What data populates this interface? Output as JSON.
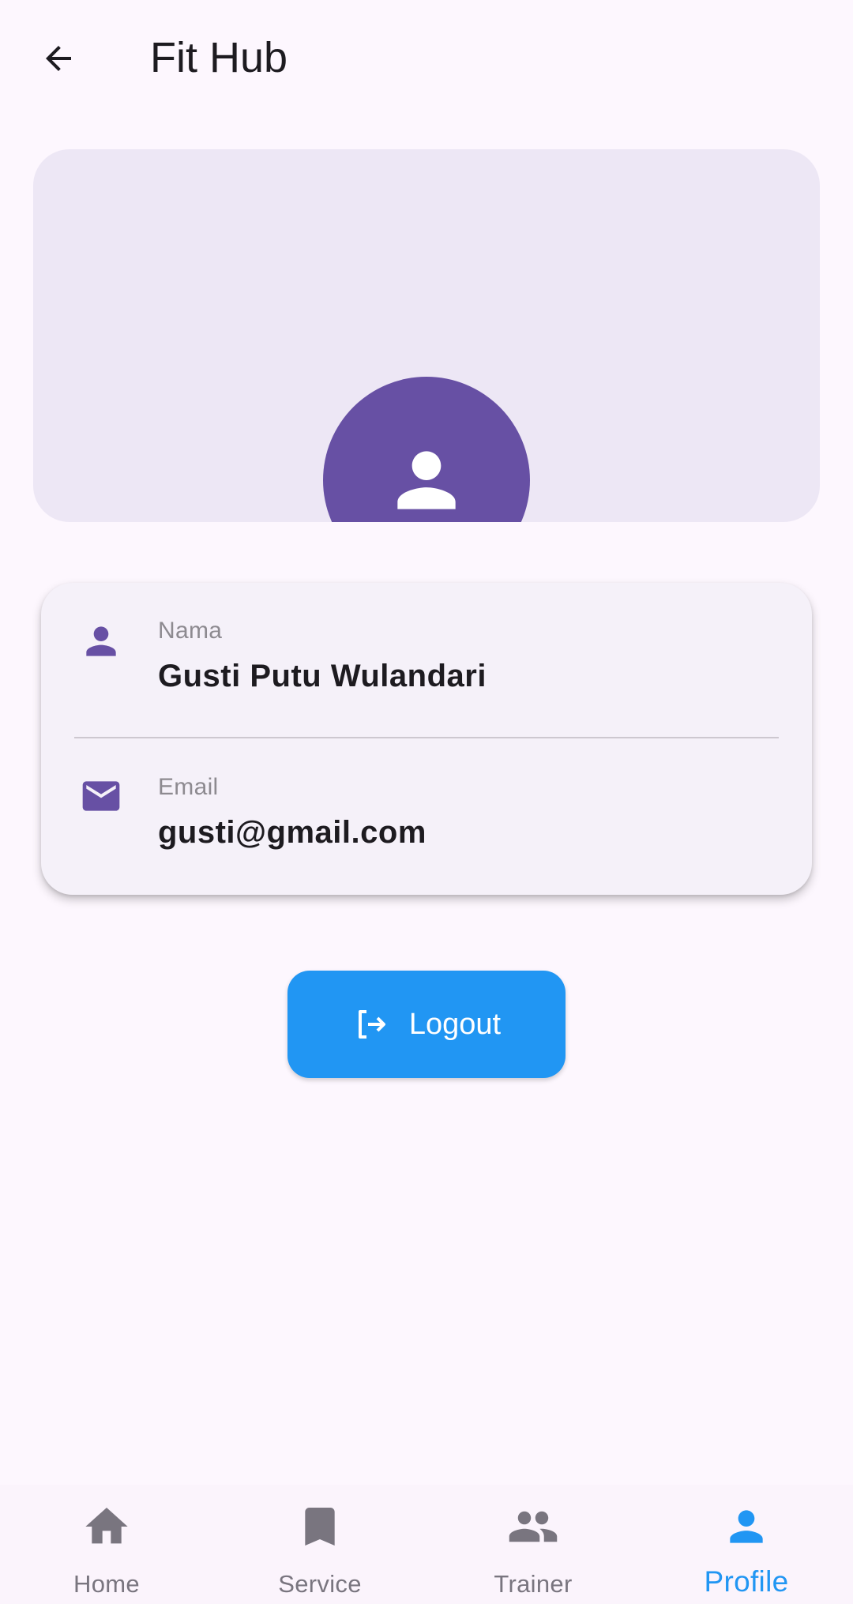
{
  "app_bar": {
    "title": "Fit Hub",
    "back_icon": "arrow-back-icon"
  },
  "header": {
    "avatar_icon": "person-icon",
    "avatar_color": "#6750a4",
    "background_color": "#ede7f5"
  },
  "profile": {
    "name_label": "Nama",
    "name_value": "Gusti Putu Wulandari",
    "name_icon": "person-icon",
    "email_label": "Email",
    "email_value": "gusti@gmail.com",
    "email_icon": "mail-icon"
  },
  "logout": {
    "label": "Logout",
    "icon": "logout-icon",
    "color": "#2196f3"
  },
  "nav": {
    "items": [
      {
        "label": "Home",
        "icon": "home-icon",
        "active": false
      },
      {
        "label": "Service",
        "icon": "bookmark-icon",
        "active": false
      },
      {
        "label": "Trainer",
        "icon": "people-icon",
        "active": false
      },
      {
        "label": "Profile",
        "icon": "person-icon",
        "active": true
      }
    ],
    "active_color": "#2196f3",
    "inactive_color": "#79757f"
  }
}
